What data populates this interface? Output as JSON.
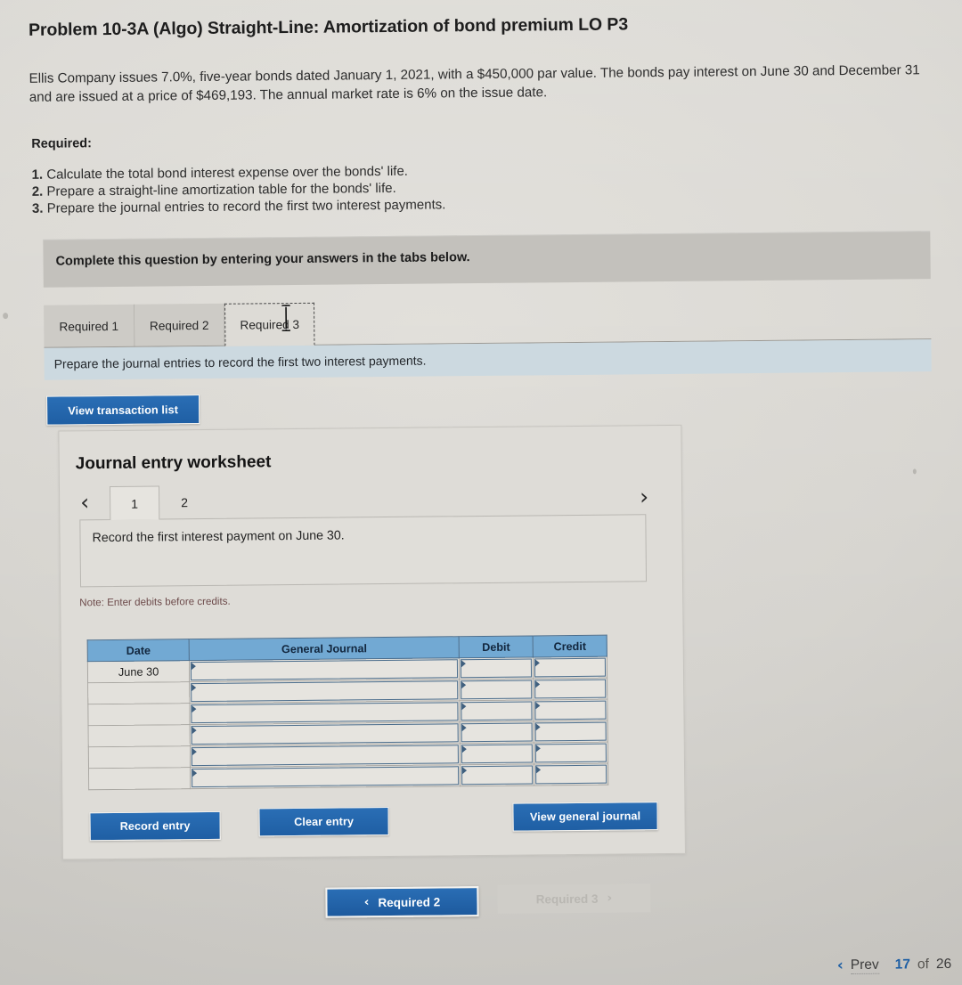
{
  "problem": {
    "title": "Problem 10-3A (Algo) Straight-Line: Amortization of bond premium LO P3",
    "intro": "Ellis Company issues 7.0%, five-year bonds dated January 1, 2021, with a $450,000 par value. The bonds pay interest on June 30 and December 31 and are issued at a price of $469,193. The annual market rate is 6% on the issue date.",
    "required_label": "Required:",
    "requirements": [
      {
        "num": "1.",
        "text": "Calculate the total bond interest expense over the bonds' life."
      },
      {
        "num": "2.",
        "text": "Prepare a straight-line amortization table for the bonds' life."
      },
      {
        "num": "3.",
        "text": "Prepare the journal entries to record the first two interest payments."
      }
    ]
  },
  "banner": {
    "text": "Complete this question by entering your answers in the tabs below."
  },
  "tabs": {
    "items": [
      {
        "label": "Required 1",
        "active": false
      },
      {
        "label": "Required 2",
        "active": false
      },
      {
        "label": "Required 3",
        "active": true
      }
    ],
    "active_instruction": "Prepare the journal entries to record the first two interest payments."
  },
  "toolbar": {
    "view_transaction_list": "View transaction list"
  },
  "worksheet": {
    "title": "Journal entry worksheet",
    "prev_icon": "chevron-left-icon",
    "next_icon": "chevron-right-icon",
    "pages": [
      {
        "label": "1",
        "active": true
      },
      {
        "label": "2",
        "active": false
      }
    ],
    "prompt": "Record the first interest payment on June 30.",
    "note": "Note: Enter debits before credits.",
    "table": {
      "columns": [
        "Date",
        "General Journal",
        "Debit",
        "Credit"
      ],
      "rows": [
        {
          "date": "June 30",
          "general_journal": "",
          "debit": "",
          "credit": ""
        },
        {
          "date": "",
          "general_journal": "",
          "debit": "",
          "credit": ""
        },
        {
          "date": "",
          "general_journal": "",
          "debit": "",
          "credit": ""
        },
        {
          "date": "",
          "general_journal": "",
          "debit": "",
          "credit": ""
        },
        {
          "date": "",
          "general_journal": "",
          "debit": "",
          "credit": ""
        },
        {
          "date": "",
          "general_journal": "",
          "debit": "",
          "credit": ""
        }
      ]
    },
    "buttons": {
      "record_entry": "Record entry",
      "clear_entry": "Clear entry",
      "view_general_journal": "View general journal"
    }
  },
  "bottom_nav": {
    "prev_chevron": "‹",
    "prev_label": "Required 2",
    "next_label": "Required 3",
    "next_chevron": "›"
  },
  "pagination": {
    "prev_chevron": "‹",
    "prev_label": "Prev",
    "current": "17",
    "of": "of",
    "total": "26"
  },
  "colors": {
    "accent_blue": "#1f5fa4",
    "table_header_blue": "#72a9d3",
    "subbar_blue": "#ccd9e0",
    "banner_grey": "#c3c1bc",
    "note_maroon": "#6d4b4b"
  }
}
